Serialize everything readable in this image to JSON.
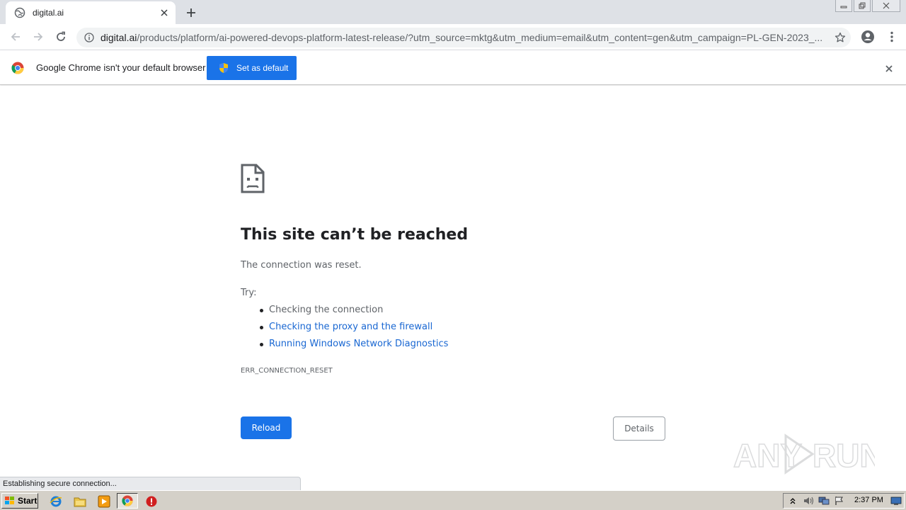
{
  "browser": {
    "tab_title": "digital.ai",
    "url_host": "digital.ai",
    "url_path": "/products/platform/ai-powered-devops-platform-latest-release/?utm_source=mktg&utm_medium=email&utm_content=gen&utm_campaign=PL-GEN-2023_...",
    "icons": {
      "favicon": "globe-icon",
      "tab_close": "close-icon",
      "new_tab": "plus-icon",
      "back": "back-arrow-icon",
      "forward": "forward-arrow-icon",
      "reload": "reload-icon",
      "site_info": "info-icon",
      "bookmark": "star-icon",
      "profile": "account-icon",
      "menu": "kebab-menu-icon"
    }
  },
  "infobar": {
    "message": "Google Chrome isn't your default browser",
    "button_label": "Set as default"
  },
  "error_page": {
    "title": "This site can’t be reached",
    "subtitle": "The connection was reset.",
    "try_label": "Try:",
    "suggestions": [
      {
        "text": "Checking the connection",
        "is_link": false
      },
      {
        "text": "Checking the proxy and the firewall",
        "is_link": true
      },
      {
        "text": "Running Windows Network Diagnostics",
        "is_link": true
      }
    ],
    "error_code": "ERR_CONNECTION_RESET",
    "reload_label": "Reload",
    "details_label": "Details"
  },
  "status_bar": {
    "text": "Establishing secure connection..."
  },
  "taskbar": {
    "start_label": "Start",
    "clock": "2:37 PM"
  },
  "colors": {
    "accent": "#1a73e8",
    "link": "#1967d2",
    "text_primary": "#202124",
    "text_secondary": "#5f6368",
    "tabstrip_bg": "#dee1e6",
    "taskbar_bg": "#d4d0c8"
  }
}
